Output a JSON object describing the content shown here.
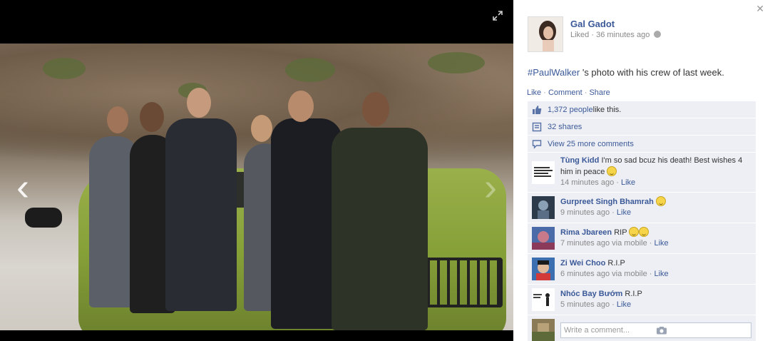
{
  "owner": {
    "name": "Gal Gadot",
    "status": "Liked",
    "time": "36 minutes ago"
  },
  "caption": {
    "hashtag": "#PaulWalker",
    "text": " 's photo with his crew of last week."
  },
  "actions": {
    "like": "Like",
    "comment": "Comment",
    "share": "Share",
    "sep": " · "
  },
  "ufi": {
    "likes_count": "1,372 people",
    "likes_suffix": " like this.",
    "shares": "32 shares",
    "more_comments": "View 25 more comments"
  },
  "comments": [
    {
      "name": "Tùng Kidd",
      "text": "I'm so sad bcuz his death! Best wishes 4 him in peace",
      "emoji": true,
      "time": "14 minutes ago",
      "via": "",
      "like": "Like"
    },
    {
      "name": "Gurpreet Singh Bhamrah",
      "text": "",
      "emoji": true,
      "time": "9 minutes ago",
      "via": "",
      "like": "Like"
    },
    {
      "name": "Rima Jbareen",
      "text": "RIP",
      "emoji": true,
      "time": "7 minutes ago",
      "via": " via mobile",
      "like": "Like"
    },
    {
      "name": "Zi Wei Choo",
      "text": "R.I.P",
      "emoji": false,
      "time": "6 minutes ago",
      "via": " via mobile",
      "like": "Like"
    },
    {
      "name": "Nhóc Bay Bướm",
      "text": "R.I.P",
      "emoji": false,
      "time": "5 minutes ago",
      "via": "",
      "like": "Like"
    }
  ],
  "write": {
    "placeholder": "Write a comment..."
  },
  "colors": {
    "link": "#3b5998",
    "panel_row": "#edeff4",
    "stage": "#000000"
  },
  "icons": [
    "expand-icon",
    "left-arrow-icon",
    "right-arrow-icon",
    "close-icon",
    "globe-icon",
    "thumbs-up-icon",
    "share-icon",
    "comment-icon",
    "camera-icon"
  ]
}
